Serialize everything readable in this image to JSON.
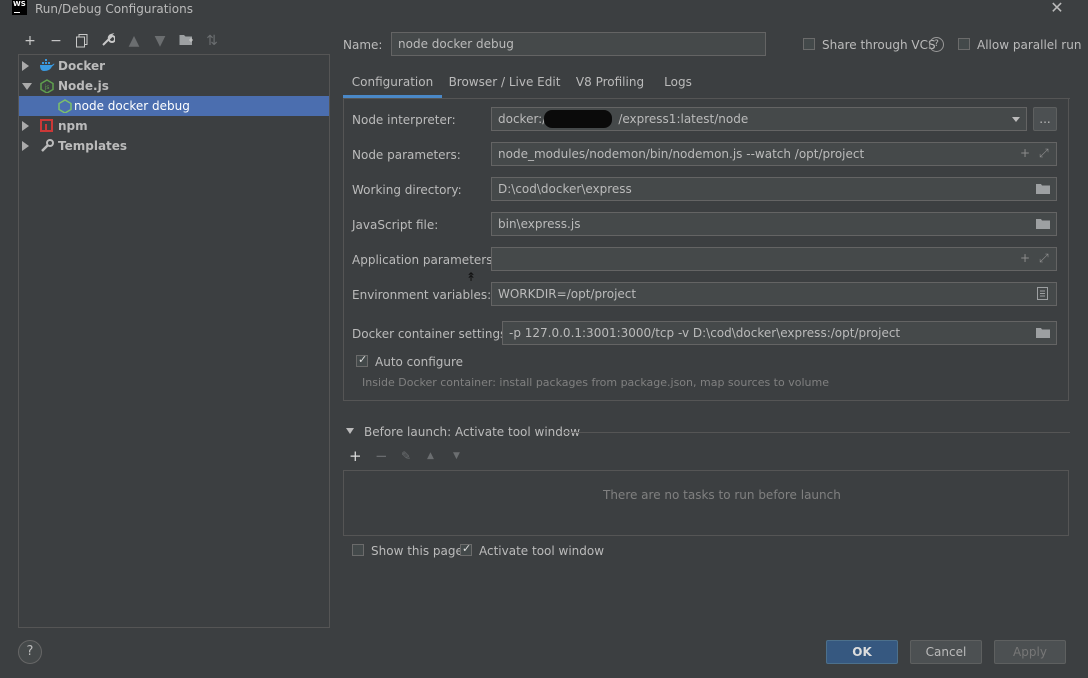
{
  "window": {
    "title": "Run/Debug Configurations",
    "app_logo": "WS"
  },
  "tree": {
    "items": [
      {
        "label": "Docker",
        "icon": "docker-icon",
        "expanded": false
      },
      {
        "label": "Node.js",
        "icon": "nodejs-icon",
        "expanded": true
      },
      {
        "label": "node docker debug",
        "icon": "nodejs-config-icon",
        "selected": true
      },
      {
        "label": "npm",
        "icon": "npm-icon",
        "expanded": false
      },
      {
        "label": "Templates",
        "icon": "wrench-icon",
        "expanded": false
      }
    ]
  },
  "name_row": {
    "name_label": "Name:",
    "name_value": "node docker debug",
    "share_vcs_label": "Share through VCS",
    "help_glyph": "?",
    "allow_parallel_label": "Allow parallel run"
  },
  "tabs": [
    {
      "label": "Configuration",
      "active": true
    },
    {
      "label": "Browser / Live Edit"
    },
    {
      "label": "V8 Profiling"
    },
    {
      "label": "Logs"
    }
  ],
  "config": {
    "node_interpreter_label": "Node interpreter:",
    "node_interpreter_value_prefix": "docker://",
    "node_interpreter_value_suffix": "/express1:latest/node",
    "browse_btn": "...",
    "node_parameters_label": "Node parameters:",
    "node_parameters_value": "node_modules/nodemon/bin/nodemon.js --watch /opt/project",
    "working_directory_label": "Working directory:",
    "working_directory_value": "D:\\cod\\docker\\express",
    "javascript_file_label": "JavaScript file:",
    "javascript_file_value": "bin\\express.js",
    "application_parameters_label": "Application parameters:",
    "application_parameters_value": "",
    "environment_variables_label": "Environment variables:",
    "environment_variables_value": "WORKDIR=/opt/project",
    "docker_container_settings_label": "Docker container settings:",
    "docker_container_settings_value": "-p 127.0.0.1:3001:3000/tcp -v D:\\cod\\docker\\express:/opt/project",
    "auto_configure_label": "Auto configure",
    "auto_configure_hint": "Inside Docker container: install packages from package.json, map sources to volume"
  },
  "before_launch": {
    "title": "Before launch: Activate tool window",
    "empty_text": "There are no tasks to run before launch",
    "show_this_page_label": "Show this page",
    "activate_tool_window_label": "Activate tool window"
  },
  "buttons": {
    "ok": "OK",
    "cancel": "Cancel",
    "apply": "Apply",
    "help": "?"
  },
  "colors": {
    "background": "#3c3f41",
    "selection": "#4b6eaf",
    "primary": "#365880",
    "tab_underline": "#4a88c7"
  }
}
